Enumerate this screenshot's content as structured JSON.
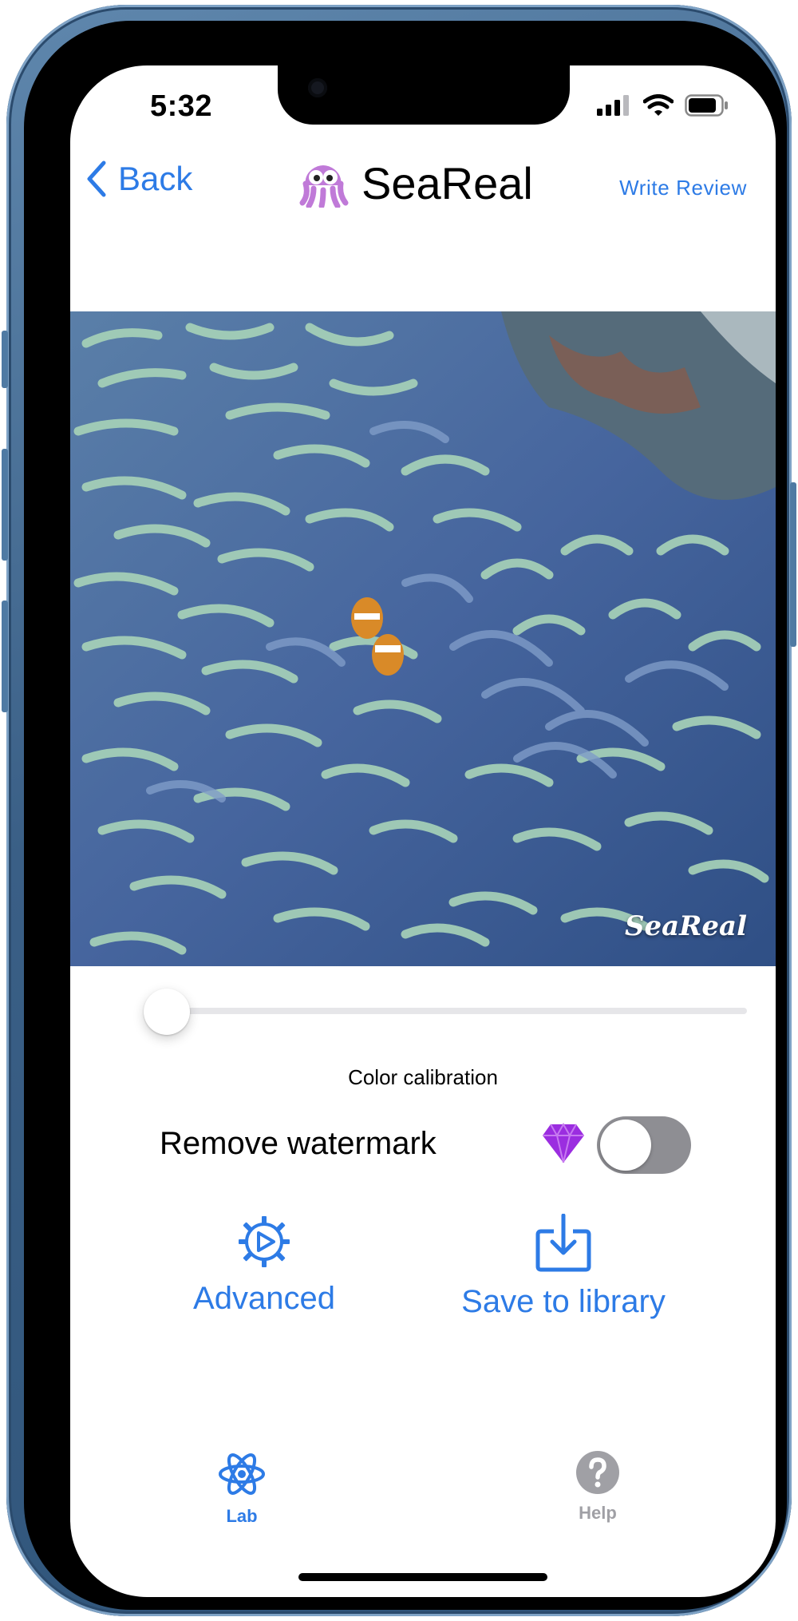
{
  "status_bar": {
    "time": "5:32"
  },
  "nav": {
    "back_label": "Back",
    "app_title": "SeaReal",
    "write_review_label": "Write Review"
  },
  "photo": {
    "watermark_text": "SeaReal"
  },
  "calibration": {
    "label": "Color calibration",
    "value_percent": 0
  },
  "watermark_option": {
    "label": "Remove watermark",
    "enabled": false,
    "premium_icon": "diamond-icon"
  },
  "actions": {
    "advanced_label": "Advanced",
    "save_label": "Save to library"
  },
  "tab_bar": {
    "items": [
      {
        "label": "Lab",
        "icon": "atom-icon",
        "active": true
      },
      {
        "label": "Help",
        "icon": "question-circle-icon",
        "active": false
      }
    ]
  },
  "colors": {
    "accent": "#2d7be6",
    "toggle_off": "#8e8e93",
    "gem": "#9b2de0",
    "frame": "#3a5f86",
    "inactive_tab": "#a0a0a5"
  }
}
